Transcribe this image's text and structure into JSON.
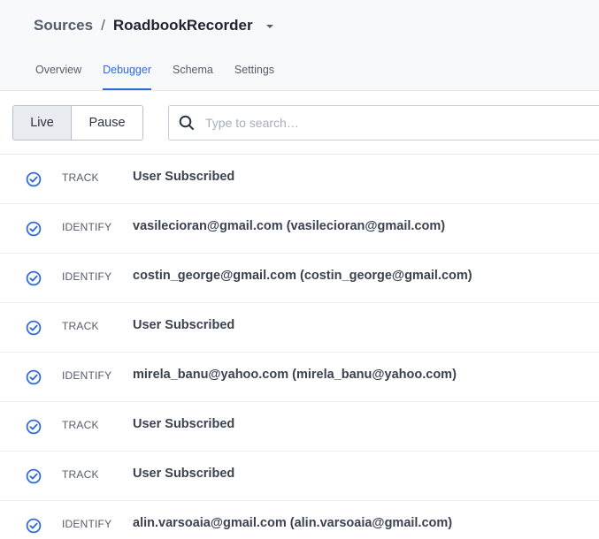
{
  "breadcrumb": {
    "parent": "Sources",
    "separator": "/",
    "current": "RoadbookRecorder"
  },
  "tabs": [
    {
      "label": "Overview",
      "active": false
    },
    {
      "label": "Debugger",
      "active": true
    },
    {
      "label": "Schema",
      "active": false
    },
    {
      "label": "Settings",
      "active": false
    }
  ],
  "toolbar": {
    "live_label": "Live",
    "pause_label": "Pause",
    "selected_mode": "Live"
  },
  "search": {
    "placeholder": "Type to search…",
    "value": "",
    "icon": "search-icon"
  },
  "events": [
    {
      "type": "TRACK",
      "name": "User Subscribed",
      "status_icon": "check-circle-icon"
    },
    {
      "type": "IDENTIFY",
      "name": "vasilecioran@gmail.com (vasilecioran@gmail.com)",
      "status_icon": "check-circle-icon"
    },
    {
      "type": "IDENTIFY",
      "name": "costin_george@gmail.com (costin_george@gmail.com)",
      "status_icon": "check-circle-icon"
    },
    {
      "type": "TRACK",
      "name": "User Subscribed",
      "status_icon": "check-circle-icon"
    },
    {
      "type": "IDENTIFY",
      "name": "mirela_banu@yahoo.com (mirela_banu@yahoo.com)",
      "status_icon": "check-circle-icon"
    },
    {
      "type": "TRACK",
      "name": "User Subscribed",
      "status_icon": "check-circle-icon"
    },
    {
      "type": "TRACK",
      "name": "User Subscribed",
      "status_icon": "check-circle-icon"
    },
    {
      "type": "IDENTIFY",
      "name": "alin.varsoaia@gmail.com (alin.varsoaia@gmail.com)",
      "status_icon": "check-circle-icon"
    }
  ],
  "colors": {
    "accent": "#2f6bd8",
    "header_bg": "#f8f9fb",
    "check": "#2f6bd8"
  }
}
